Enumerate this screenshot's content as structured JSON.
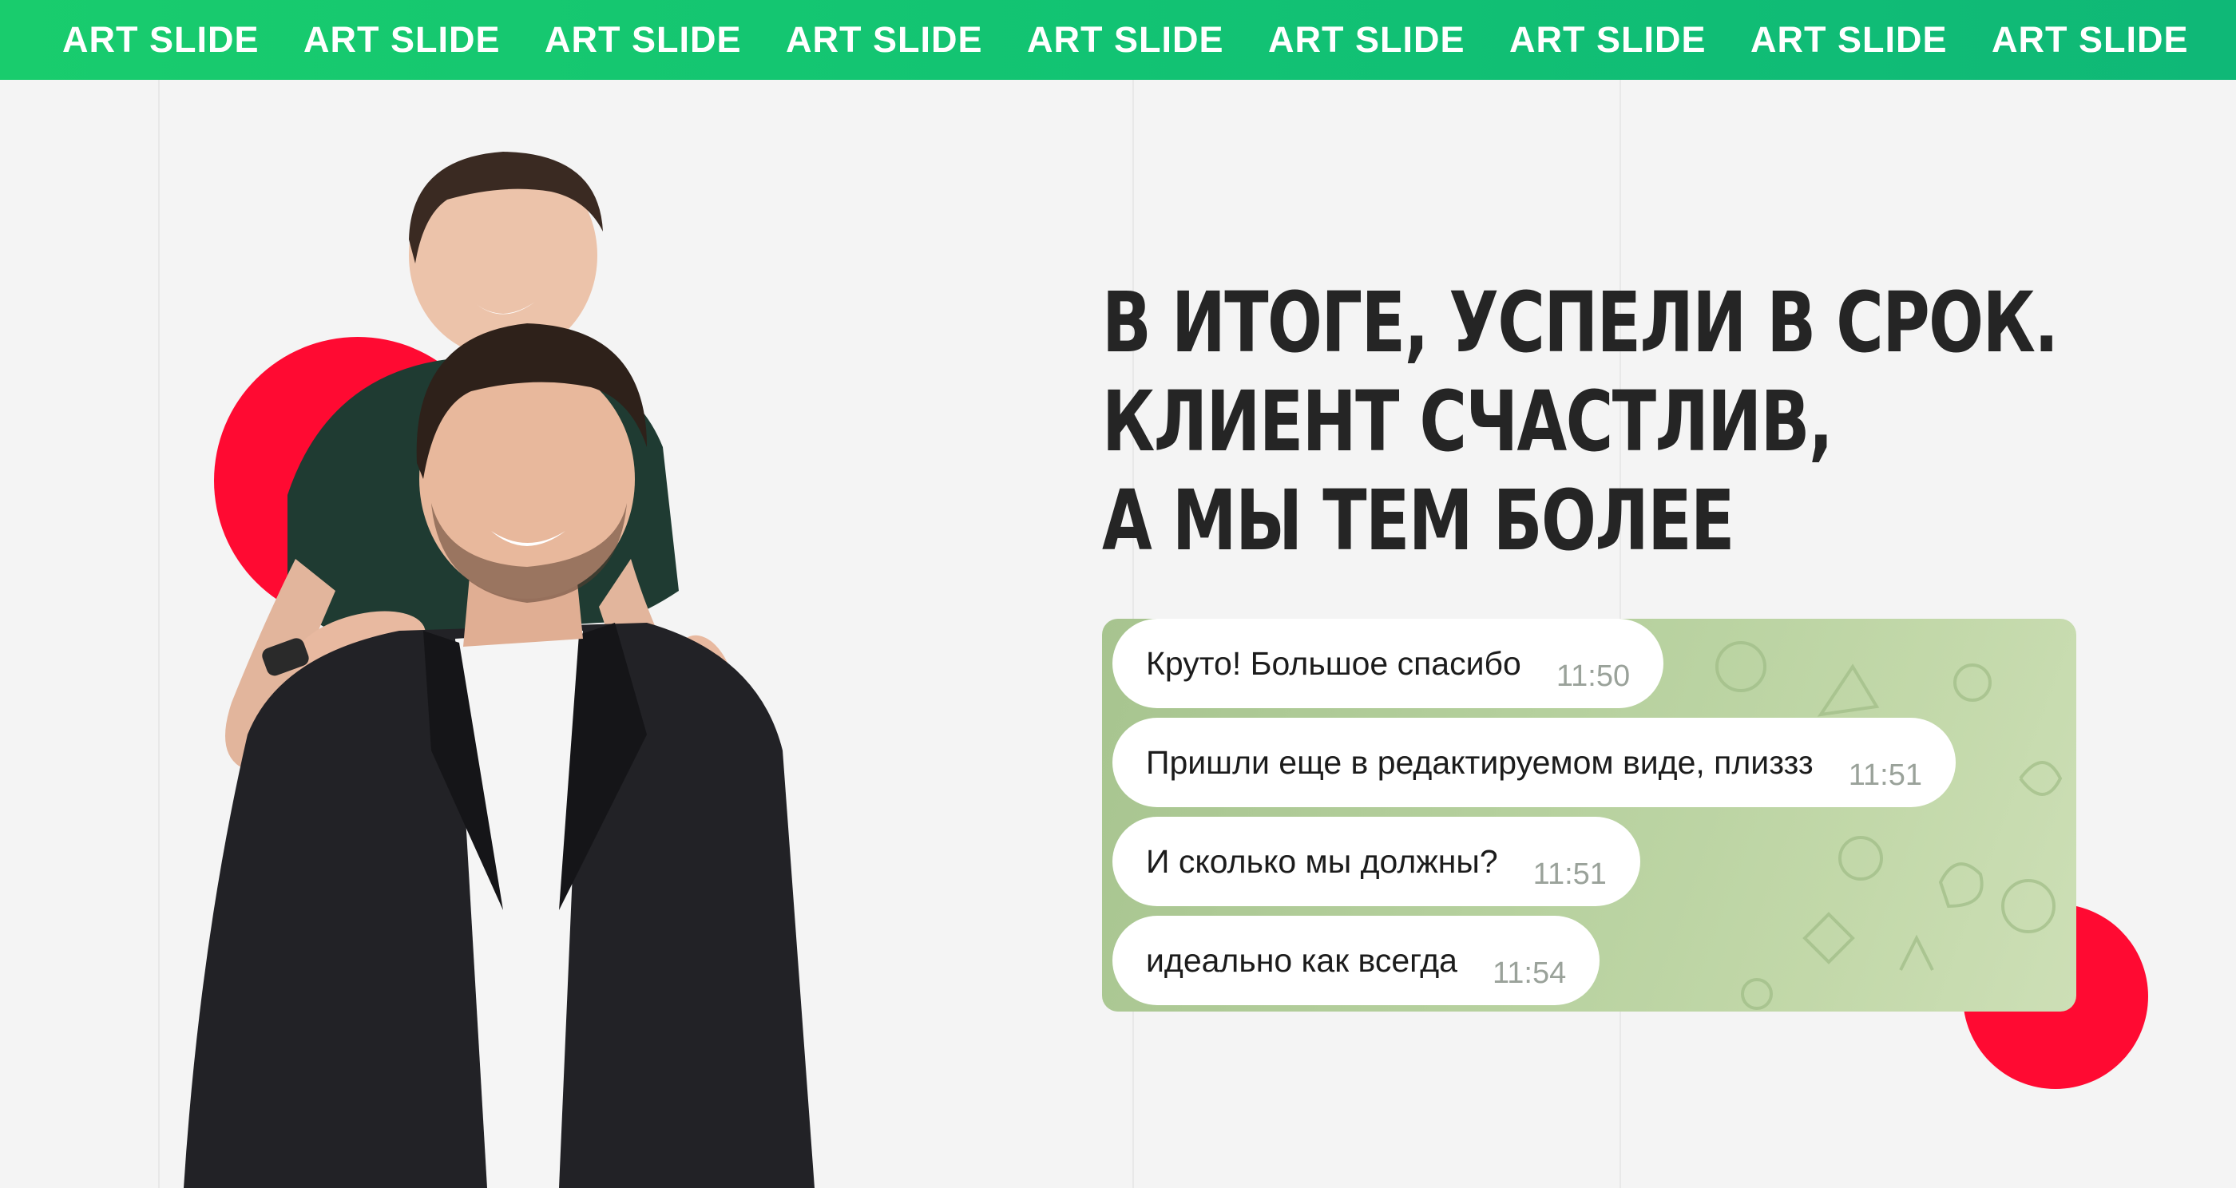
{
  "ticker": {
    "items": [
      "ART SLIDE",
      "ART SLIDE",
      "ART SLIDE",
      "ART SLIDE",
      "ART SLIDE",
      "ART SLIDE",
      "ART SLIDE",
      "ART SLIDE",
      "ART SLIDE"
    ]
  },
  "headline": {
    "line1": "В ИТОГЕ, УСПЕЛИ В СРОК.",
    "line2": "КЛИЕНТ СЧАСТЛИВ,",
    "line3": "А МЫ ТЕМ БОЛЕЕ"
  },
  "chat": {
    "messages": [
      {
        "text": "Круто! Большое спасибо",
        "time": "11:50"
      },
      {
        "text": "Пришли еще в редактируемом виде, плиззз",
        "time": "11:51"
      },
      {
        "text": "И сколько мы должны?",
        "time": "11:51"
      },
      {
        "text": "идеально как всегда",
        "time": "11:54"
      }
    ]
  },
  "colors": {
    "ticker_green": "#12c373",
    "accent_red": "#ff0a32",
    "headline_text": "#252525",
    "chat_bg": "#b4cf9c"
  }
}
